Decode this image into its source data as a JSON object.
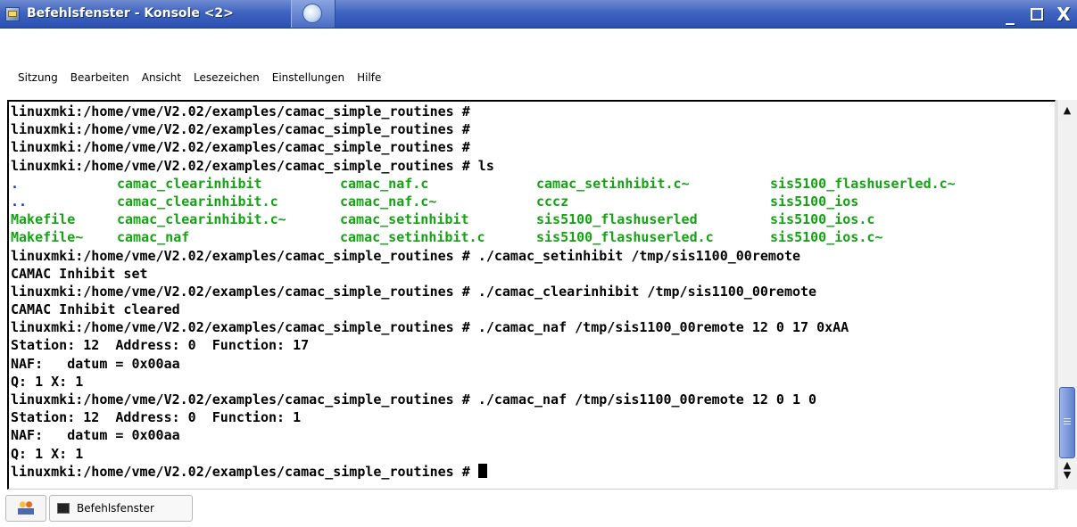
{
  "window": {
    "title": "Befehlsfenster - Konsole <2>",
    "buttons": {
      "minimize": "_",
      "close": "X"
    }
  },
  "menu": [
    "Sitzung",
    "Bearbeiten",
    "Ansicht",
    "Lesezeichen",
    "Einstellungen",
    "Hilfe"
  ],
  "terminal": {
    "lines_before_ls": [
      "linuxmki:/home/vme/V2.02/examples/camac_simple_routines #",
      "linuxmki:/home/vme/V2.02/examples/camac_simple_routines #",
      "linuxmki:/home/vme/V2.02/examples/camac_simple_routines #",
      "linuxmki:/home/vme/V2.02/examples/camac_simple_routines # ls"
    ],
    "ls_rows": [
      [
        ".",
        "camac_clearinhibit",
        "camac_naf.c",
        "camac_setinhibit.c~",
        "sis5100_flashuserled.c~"
      ],
      [
        "..",
        "camac_clearinhibit.c",
        "camac_naf.c~",
        "cccz",
        "sis5100_ios"
      ],
      [
        "Makefile",
        "camac_clearinhibit.c~",
        "camac_setinhibit",
        "sis5100_flashuserled",
        "sis5100_ios.c"
      ],
      [
        "Makefile~",
        "camac_naf",
        "camac_setinhibit.c",
        "sis5100_flashuserled.c",
        "sis5100_ios.c~"
      ]
    ],
    "lines_after_ls": [
      "linuxmki:/home/vme/V2.02/examples/camac_simple_routines # ./camac_setinhibit /tmp/sis1100_00remote",
      "CAMAC Inhibit set",
      "linuxmki:/home/vme/V2.02/examples/camac_simple_routines # ./camac_clearinhibit /tmp/sis1100_00remote",
      "CAMAC Inhibit cleared",
      "linuxmki:/home/vme/V2.02/examples/camac_simple_routines # ./camac_naf /tmp/sis1100_00remote 12 0 17 0xAA",
      "Station: 12  Address: 0  Function: 17",
      "NAF:   datum = 0x00aa",
      "Q: 1 X: 1",
      "linuxmki:/home/vme/V2.02/examples/camac_simple_routines # ./camac_naf /tmp/sis1100_00remote 12 0 1 0",
      "Station: 12  Address: 0  Function: 1",
      "NAF:   datum = 0x00aa",
      "Q: 1 X: 1"
    ],
    "prompt": "linuxmki:/home/vme/V2.02/examples/camac_simple_routines # ",
    "colors": {
      "dir": "#1f32c8",
      "exec": "#13a313",
      "text": "#000000"
    }
  },
  "taskbar": {
    "session_tab": "Befehlsfenster"
  },
  "icons": [
    "konsole-app-icon",
    "konqueror-icon",
    "up-arrow-icon",
    "down-arrow-icon",
    "new-session-icon",
    "terminal-icon"
  ]
}
